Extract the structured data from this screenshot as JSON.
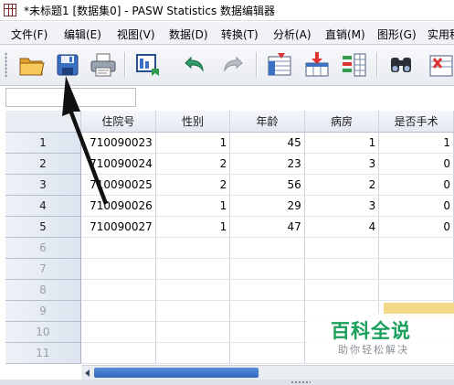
{
  "window": {
    "title": "*未标题1 [数据集0] - PASW Statistics 数据编辑器"
  },
  "menu": {
    "items": [
      {
        "label": "文件(F)"
      },
      {
        "label": "编辑(E)"
      },
      {
        "label": "视图(V)"
      },
      {
        "label": "数据(D)"
      },
      {
        "label": "转换(T)"
      },
      {
        "label": "分析(A)"
      },
      {
        "label": "直销(M)"
      },
      {
        "label": "图形(G)"
      },
      {
        "label": "实用程"
      }
    ]
  },
  "toolbar": {
    "buttons": [
      {
        "icon": "open-folder-icon"
      },
      {
        "icon": "save-icon"
      },
      {
        "icon": "print-icon"
      },
      {
        "icon": "dialog-recall-icon"
      },
      {
        "icon": "undo-icon"
      },
      {
        "icon": "redo-icon"
      },
      {
        "icon": "goto-case-icon"
      },
      {
        "icon": "goto-variable-icon"
      },
      {
        "icon": "variables-icon"
      },
      {
        "icon": "find-icon"
      },
      {
        "icon": "insert-case-icon"
      }
    ]
  },
  "editor": {
    "cell_reference": "",
    "cell_value": ""
  },
  "grid": {
    "columns": [
      "住院号",
      "性别",
      "年龄",
      "病房",
      "是否手术"
    ],
    "rows": [
      {
        "num": "1",
        "cells": [
          "710090023",
          "1",
          "45",
          "1",
          "1"
        ]
      },
      {
        "num": "2",
        "cells": [
          "710090024",
          "2",
          "23",
          "3",
          "0"
        ]
      },
      {
        "num": "3",
        "cells": [
          "710090025",
          "2",
          "56",
          "2",
          "0"
        ]
      },
      {
        "num": "4",
        "cells": [
          "710090026",
          "1",
          "29",
          "3",
          "0"
        ]
      },
      {
        "num": "5",
        "cells": [
          "710090027",
          "1",
          "47",
          "4",
          "0"
        ]
      },
      {
        "num": "6",
        "cells": [
          "",
          "",
          "",
          "",
          ""
        ]
      },
      {
        "num": "7",
        "cells": [
          "",
          "",
          "",
          "",
          ""
        ]
      },
      {
        "num": "8",
        "cells": [
          "",
          "",
          "",
          "",
          ""
        ]
      },
      {
        "num": "9",
        "cells": [
          "",
          "",
          "",
          "",
          ""
        ]
      },
      {
        "num": "10",
        "cells": [
          "",
          "",
          "",
          "",
          ""
        ]
      },
      {
        "num": "11",
        "cells": [
          "",
          "",
          "",
          "",
          ""
        ]
      }
    ]
  },
  "watermark": {
    "title": "百科全说",
    "subtitle": "助你轻松解决"
  },
  "colors": {
    "accent": "#2f66bd",
    "watermark_green": "#19a05a",
    "annotation_arrow": "#111111"
  }
}
